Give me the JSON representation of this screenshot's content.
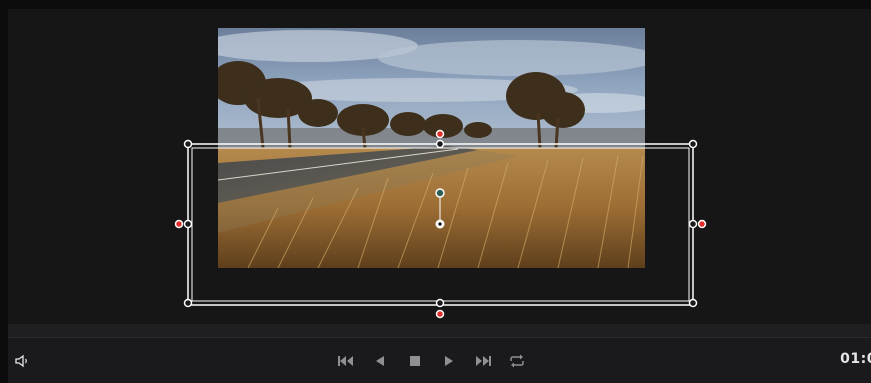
{
  "app": {
    "name": "video-viewer"
  },
  "transport": {
    "audio_icon": "speaker-icon",
    "buttons": [
      {
        "name": "jump-to-start-button",
        "icon": "skip-start-icon"
      },
      {
        "name": "play-reverse-button",
        "icon": "play-reverse-icon"
      },
      {
        "name": "stop-button",
        "icon": "stop-icon"
      },
      {
        "name": "play-button",
        "icon": "play-icon"
      },
      {
        "name": "jump-to-end-button",
        "icon": "skip-end-icon"
      },
      {
        "name": "loop-button",
        "icon": "loop-icon"
      }
    ],
    "timecode": "01:0"
  },
  "colors": {
    "background": "#161617",
    "transport_bg": "#1a1a1c",
    "handle_white": "#ffffff",
    "handle_red": "#e0302a",
    "icon_gray": "#8f8f94",
    "timecode_text": "#e6e6e8"
  }
}
